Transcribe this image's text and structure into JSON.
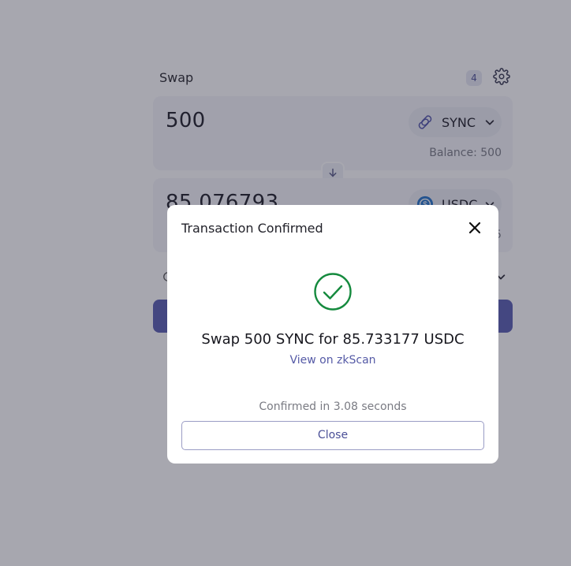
{
  "swap": {
    "title": "Swap",
    "pending_count": "4",
    "from": {
      "amount": "500",
      "token": "SYNC",
      "balance": "Balance: 500"
    },
    "to": {
      "amount": "85.076793",
      "token": "USDC",
      "balance_suffix": "5"
    }
  },
  "modal": {
    "title": "Transaction Confirmed",
    "summary": "Swap 500 SYNC for 85.733177 USDC",
    "link_label": "View on zkScan",
    "confirmed_text": "Confirmed in 3.08 seconds",
    "close_label": "Close"
  },
  "colors": {
    "accent": "#5b5fb3",
    "success": "#158a3e",
    "usdc": "#2775ca",
    "overlay": "rgba(35,35,55,0.40)"
  },
  "icons": {
    "settings": "gear-icon",
    "sync_token": "sync-token-icon",
    "usdc_token": "usdc-token-icon",
    "flip": "arrow-down-icon",
    "close": "close-icon",
    "success": "check-circle-icon"
  }
}
